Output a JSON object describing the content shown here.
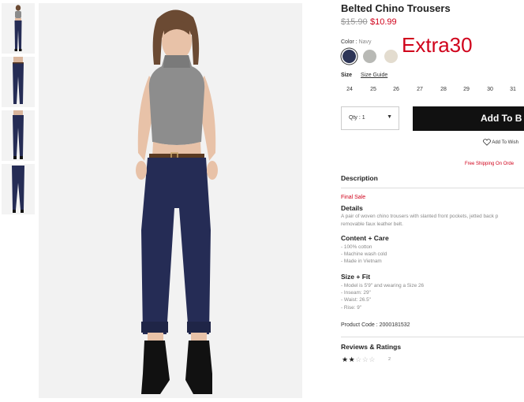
{
  "product": {
    "title": "Belted Chino Trousers",
    "price_original": "$15.90",
    "price_sale": "$10.99",
    "promo_text": "Extra30",
    "color_label": "Color :",
    "color_value": "Navy",
    "colors": [
      "#2d3557",
      "#b8b9b5",
      "#e3dccf"
    ],
    "size_label": "Size",
    "size_guide": "Size Guide",
    "sizes": [
      "24",
      "25",
      "26",
      "27",
      "28",
      "29",
      "30",
      "31"
    ],
    "qty_label": "Qty : 1",
    "add_button": "Add To B",
    "wishlist": "Add To Wish",
    "shipping": "Free Shipping On Orde"
  },
  "description": {
    "heading": "Description",
    "final_sale": "Final Sale",
    "details_heading": "Details",
    "details_lines": [
      "A pair of woven chino trousers with slanted front pockets, jetted back p",
      "removable faux leather belt."
    ],
    "content_heading": "Content + Care",
    "content_items": [
      "- 100% cotton",
      "- Machine wash cold",
      "- Made in Vietnam"
    ],
    "fit_heading": "Size + Fit",
    "fit_items": [
      "- Model is 5'9\" and wearing a Size 26",
      "- Inseam: 29\"",
      "- Waist: 26.5\"",
      "- Rise: 9\""
    ],
    "product_code": "Product Code : 2000181532"
  },
  "reviews": {
    "heading": "Reviews & Ratings",
    "rating": 2,
    "max": 5,
    "count": "2"
  }
}
